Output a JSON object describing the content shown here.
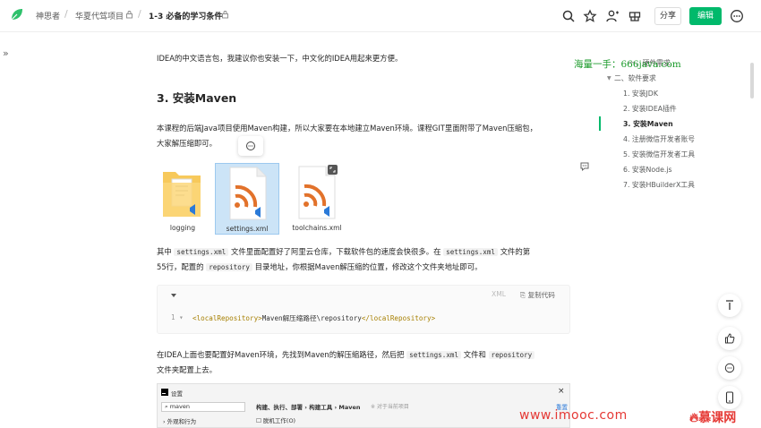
{
  "header": {
    "breadcrumbs": [
      "神思者",
      "华夏代驾项目",
      "1-3 必备的学习条件"
    ],
    "share_label": "分享",
    "edit_label": "编辑"
  },
  "article": {
    "intro_text": "IDEA的中文语言包，我建议你也安装一下，中文化的IDEA用起来更方便。",
    "heading": "3. 安装Maven",
    "para1_line1": "本课程的后端Java项目使用Maven构建，所以大家要在本地建立Maven环境。课程GIT里面附带了Maven压缩包，",
    "para1_line2": "大家解压缩即可。",
    "files": [
      {
        "name": "logging",
        "type": "folder"
      },
      {
        "name": "settings.xml",
        "type": "xml"
      },
      {
        "name": "toolchains.xml",
        "type": "xml"
      }
    ],
    "para2_line1": {
      "a": "其中",
      "code1": "settings.xml",
      "b": "文件里面配置好了阿里云仓库，下载软件包的速度会快很多。在",
      "code2": "settings.xml",
      "c": "文件的第"
    },
    "para2_line2": {
      "a": "55行，配置的",
      "code1": "repository",
      "b": "目录地址，你根据Maven解压缩的位置，修改这个文件夹地址即可。"
    },
    "code_block": {
      "lang": "XML",
      "copy_label": "复制代码",
      "line_number": "1",
      "open_tag": "<localRepository>",
      "content": "Maven解压缩路径\\repository",
      "close_tag": "</localRepository>"
    },
    "para3_line1": {
      "a": "在IDEA上面也要配置好Maven环境，先找到Maven的解压缩路径，然后把",
      "code1": "settings.xml",
      "b": "文件和",
      "code2": "repository"
    },
    "para3_line2": "文件夹配置上去。",
    "screenshot": {
      "title": "设置",
      "search_value": "maven",
      "breadcrumb": "构建、执行、部署 › 构建工具 › Maven",
      "note": "※ 对于当前项目",
      "reset": "重置",
      "checkbox_label": "脱机工作(O)",
      "tree_item": "外观和行为"
    }
  },
  "toc": {
    "items": [
      {
        "label": "一、硬件需求",
        "level": 1
      },
      {
        "label": "二、软件要求",
        "level": 1
      },
      {
        "label": "1. 安装JDK",
        "level": 2
      },
      {
        "label": "2. 安装IDEA插件",
        "level": 2
      },
      {
        "label": "3. 安装Maven",
        "level": 2,
        "active": true
      },
      {
        "label": "4. 注册微信开发者账号",
        "level": 2
      },
      {
        "label": "5. 安装微信开发者工具",
        "level": 2
      },
      {
        "label": "6. 安装Node.js",
        "level": 2
      },
      {
        "label": "7. 安装HBuilderX工具",
        "level": 2
      }
    ]
  },
  "watermarks": {
    "top": "海量一手：666java.com",
    "bottom_url": "www.imooc.com",
    "bottom_brand": "慕课网"
  },
  "colors": {
    "accent": "#00b96b",
    "watermark_green": "#1a9a2a",
    "imooc_red": "#e53935"
  }
}
